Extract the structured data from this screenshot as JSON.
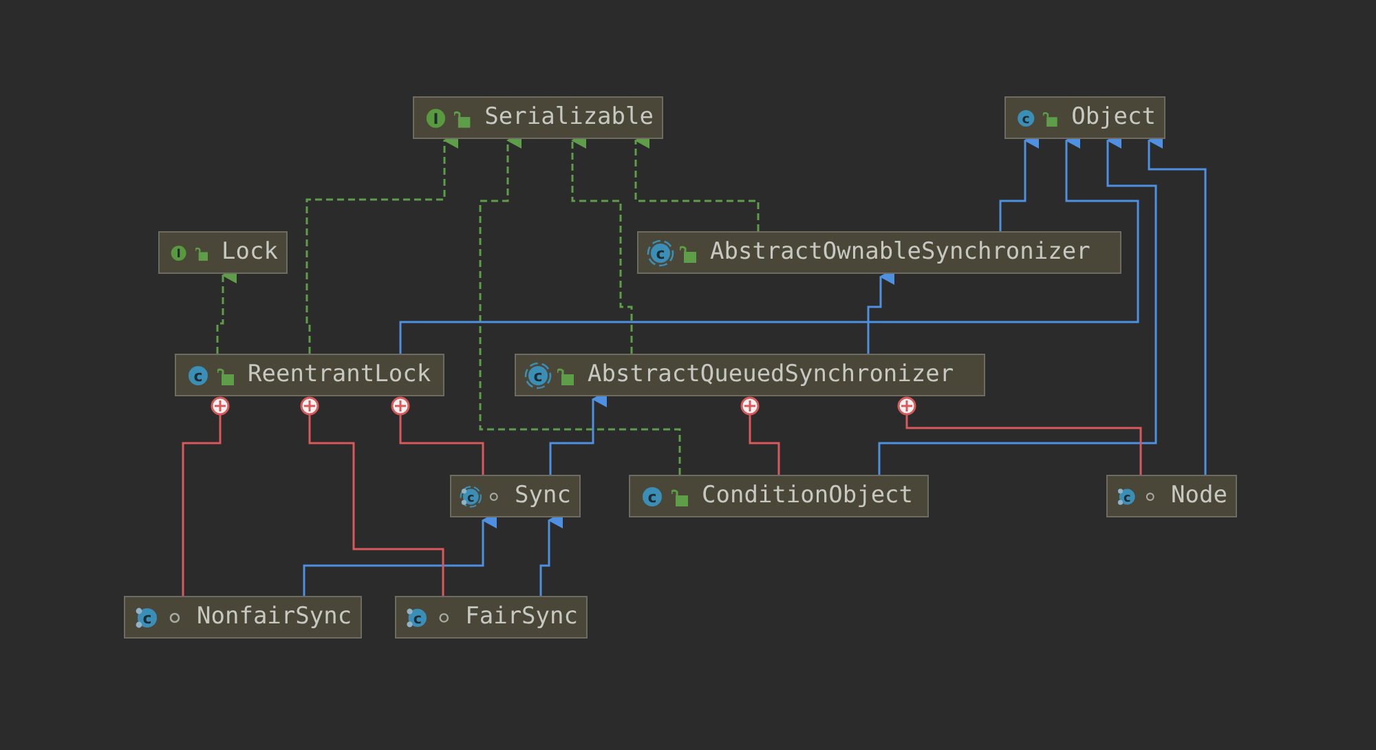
{
  "diagram": {
    "nodes": [
      {
        "name": "Serializable",
        "kind": "interface",
        "icon_letter": "I",
        "static_nested": false,
        "public": true
      },
      {
        "name": "Object",
        "kind": "class",
        "icon_letter": "c",
        "static_nested": false,
        "public": true
      },
      {
        "name": "Lock",
        "kind": "interface",
        "icon_letter": "I",
        "static_nested": false,
        "public": true
      },
      {
        "name": "AbstractOwnableSynchronizer",
        "kind": "abstract_class",
        "icon_letter": "c",
        "static_nested": false,
        "public": true
      },
      {
        "name": "ReentrantLock",
        "kind": "class",
        "icon_letter": "c",
        "static_nested": false,
        "public": true
      },
      {
        "name": "AbstractQueuedSynchronizer",
        "kind": "abstract_class",
        "icon_letter": "c",
        "static_nested": false,
        "public": true
      },
      {
        "name": "Sync",
        "kind": "abstract_class",
        "icon_letter": "c",
        "static_nested": true,
        "public": false
      },
      {
        "name": "ConditionObject",
        "kind": "class",
        "icon_letter": "c",
        "static_nested": false,
        "public": true
      },
      {
        "name": "Node",
        "kind": "class",
        "icon_letter": "c",
        "static_nested": true,
        "public": false
      },
      {
        "name": "NonfairSync",
        "kind": "class",
        "icon_letter": "c",
        "static_nested": true,
        "public": false
      },
      {
        "name": "FairSync",
        "kind": "class",
        "icon_letter": "c",
        "static_nested": true,
        "public": false
      }
    ],
    "edges": [
      {
        "kind": "implements"
      },
      {
        "kind": "implements"
      },
      {
        "kind": "implements"
      },
      {
        "kind": "implements"
      },
      {
        "kind": "implements"
      },
      {
        "kind": "extends"
      },
      {
        "kind": "extends"
      },
      {
        "kind": "extends"
      },
      {
        "kind": "extends"
      },
      {
        "kind": "extends"
      },
      {
        "kind": "extends"
      },
      {
        "kind": "extends"
      },
      {
        "kind": "extends"
      },
      {
        "kind": "inner"
      },
      {
        "kind": "inner"
      },
      {
        "kind": "inner"
      },
      {
        "kind": "inner"
      },
      {
        "kind": "inner"
      }
    ]
  }
}
